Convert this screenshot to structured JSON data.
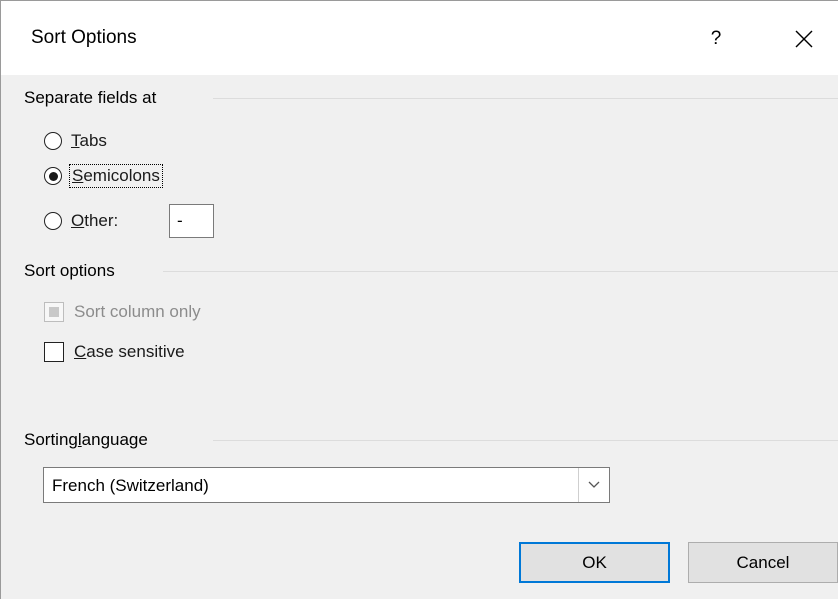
{
  "window": {
    "title": "Sort Options",
    "help_label": "?"
  },
  "separate_fields": {
    "header": "Separate fields at",
    "options": [
      {
        "label_prefix": "",
        "access_key": "T",
        "label_rest": "abs",
        "selected": false
      },
      {
        "label_prefix": "",
        "access_key": "S",
        "label_rest": "emicolons",
        "selected": true
      },
      {
        "label_prefix": "",
        "access_key": "O",
        "label_rest": "ther:",
        "selected": false
      }
    ],
    "other_value": "-"
  },
  "sort_options": {
    "header": "Sort options",
    "sort_column_only": {
      "label": "Sort column only",
      "checked": true,
      "enabled": false
    },
    "case_sensitive": {
      "access_key": "C",
      "label_rest": "ase sensitive",
      "checked": false,
      "enabled": true
    }
  },
  "sorting_language": {
    "header_prefix": "Sorting ",
    "header_access_key": "l",
    "header_rest": "anguage",
    "selected": "French (Switzerland)"
  },
  "buttons": {
    "ok": "OK",
    "cancel": "Cancel"
  },
  "colors": {
    "accent": "#0078d7",
    "dialog_bg": "#f0f0f0",
    "titlebar_bg": "#ffffff"
  }
}
